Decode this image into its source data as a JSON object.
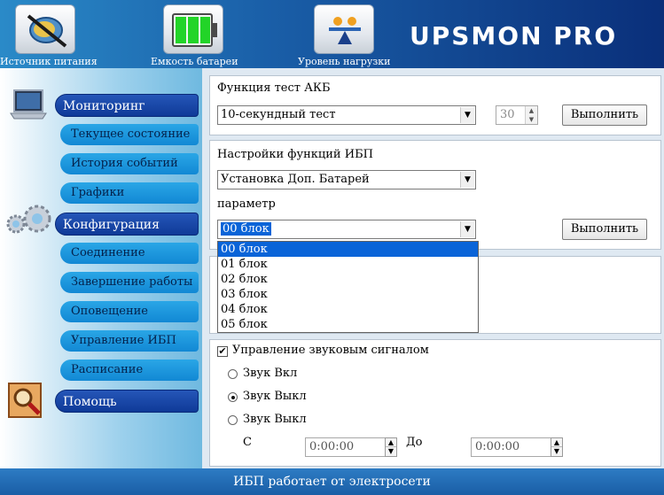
{
  "header": {
    "buttons": [
      {
        "label": "Источник питания",
        "icon": "plug-icon"
      },
      {
        "label": "Емкость батареи",
        "icon": "battery-icon"
      },
      {
        "label": "Уровень нагрузки",
        "icon": "load-scale-icon"
      }
    ],
    "brand": "UPSMON PRO"
  },
  "sidebar": {
    "monitoring": {
      "label": "Мониторинг",
      "items": [
        "Текущее состояние",
        "История событий",
        "Графики"
      ]
    },
    "configuration": {
      "label": "Конфигурация",
      "items": [
        "Соединение",
        "Завершение работы",
        "Оповещение",
        "Управление ИБП",
        "Расписание"
      ]
    },
    "help": {
      "label": "Помощь"
    }
  },
  "battery_test": {
    "title": "Функция тест АКБ",
    "selected": "10-секундный тест",
    "spin_value": "30",
    "run_label": "Выполнить"
  },
  "ups_settings": {
    "title": "Настройки функций ИБП",
    "function_selected": "Установка Доп. Батарей",
    "param_label": "параметр",
    "param_selected": "00 блок",
    "run_label": "Выполнить",
    "options": [
      "00 блок",
      "01 блок",
      "02 блок",
      "03 блок",
      "04 блок",
      "05 блок"
    ]
  },
  "sound": {
    "title": "Управление звуковым сигналом",
    "opt_on": "Звук Вкл",
    "opt_off": "Звук Выкл",
    "opt_off2": "Звук Выкл",
    "from_label": "С",
    "to_label": "До",
    "from_time": "0:00:00",
    "to_time": "0:00:00"
  },
  "status": {
    "text": "ИБП работает от электросети"
  },
  "colors": {
    "accent": "#0a64d8",
    "header_dark": "#0a2f7a"
  }
}
